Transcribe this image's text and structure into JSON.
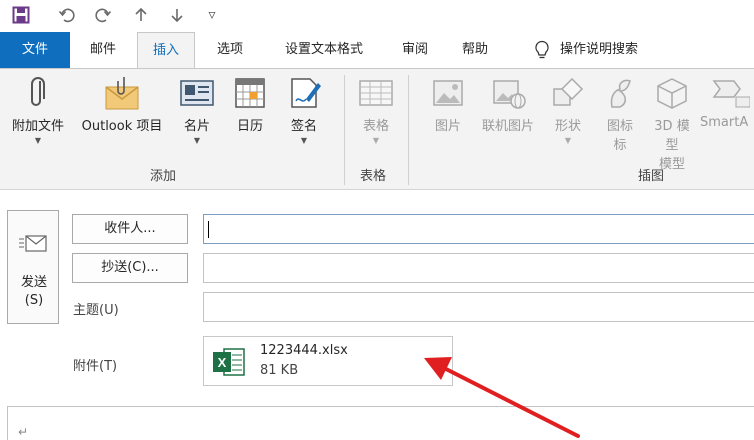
{
  "quick_access": {
    "icons": [
      "save-icon",
      "undo-icon",
      "redo-icon",
      "arrow-up-icon",
      "arrow-down-icon",
      "customize-icon"
    ],
    "dropdown_glyph": "▿"
  },
  "tabs": [
    "文件",
    "邮件",
    "插入",
    "选项",
    "设置文本格式",
    "审阅",
    "帮助"
  ],
  "tell_me": "操作说明搜索",
  "ribbon": {
    "add_group": {
      "label": "添加",
      "buttons": [
        "附加文件",
        "Outlook 项目",
        "名片",
        "日历",
        "签名"
      ]
    },
    "table_group": {
      "label": "表格",
      "buttons": [
        "表格"
      ]
    },
    "illustrations_group": {
      "label": "插图",
      "buttons": [
        "图片",
        "联机图片",
        "形状",
        "图标",
        "3D 模型",
        "SmartA"
      ]
    },
    "icon_line2": "标",
    "model_line2": "模型"
  },
  "compose": {
    "send_label": "发送",
    "send_shortcut": "(S)",
    "to_button": "收件人...",
    "cc_button": "抄送(C)...",
    "subject_label": "主题(U)",
    "attachment_label": "附件(T)",
    "to_value": "",
    "cc_value": "",
    "subject_value": "",
    "attachment": {
      "file_name": "1223444.xlsx",
      "file_size": "81 KB",
      "app_badge": "X"
    },
    "return_glyph": "↵"
  },
  "colors": {
    "file_tab": "#106ebe",
    "excel_green": "#1e7145",
    "annotation_arrow": "#e02020"
  }
}
